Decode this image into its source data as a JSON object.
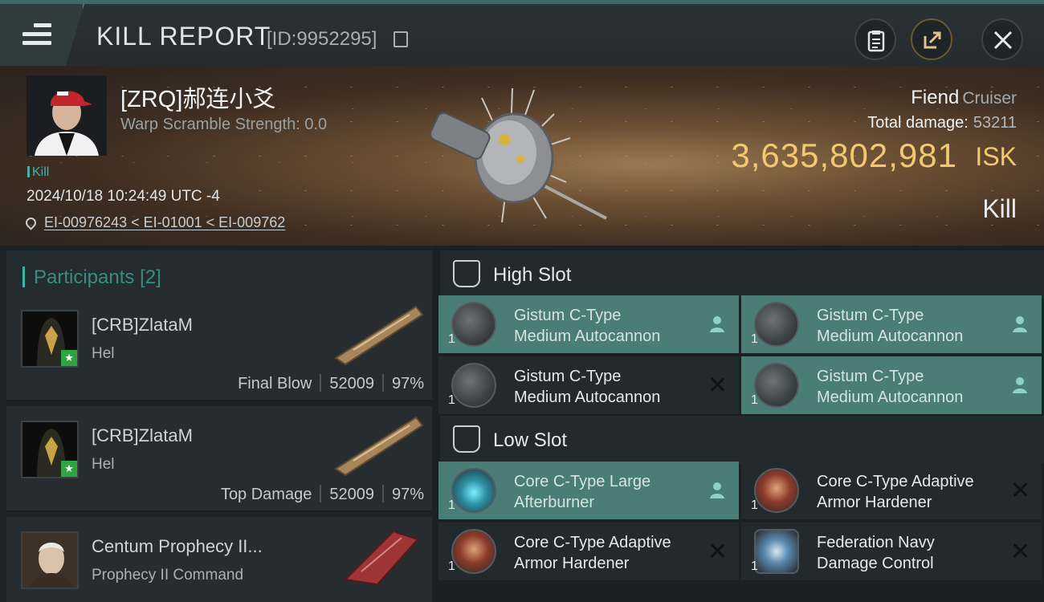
{
  "header": {
    "title": "KILL REPORT",
    "report_id": "[ID:9952295]",
    "icons": {
      "menu": "hamburger-menu-icon",
      "copy": "copy-icon",
      "clipboard": "clipboard-icon",
      "share": "share-icon",
      "close": "close-icon"
    }
  },
  "victim": {
    "name": "[ZRQ]郝连小爻",
    "warp_scramble": "Warp Scramble Strength: 0.0",
    "tag": "Kill",
    "timestamp": "2024/10/18 10:24:49 UTC -4",
    "location": "EI-00976243 < EI-01001 < EI-009762",
    "ship_name": "Fiend",
    "ship_class": "Cruiser",
    "total_damage_label": "Total damage:",
    "total_damage": "53211",
    "isk_value": "3,635,802,981",
    "isk_unit": "ISK",
    "result": "Kill"
  },
  "participants": {
    "title": "Participants",
    "count": "[2]",
    "rows": [
      {
        "name": "[CRB]ZlataM",
        "ship": "Hel",
        "role": "Final Blow",
        "damage": "52009",
        "percent": "97%"
      },
      {
        "name": "[CRB]ZlataM",
        "ship": "Hel",
        "role": "Top Damage",
        "damage": "52009",
        "percent": "97%"
      },
      {
        "name": "Centum Prophecy II...",
        "ship": "Prophecy II Command",
        "role": "",
        "damage": "",
        "percent": ""
      }
    ]
  },
  "fitting": {
    "high_slot": {
      "title": "High Slot",
      "modules": [
        {
          "qty": "1",
          "line1": "Gistum C-Type",
          "line2": "Medium Autocannon",
          "status": "dropped"
        },
        {
          "qty": "1",
          "line1": "Gistum C-Type",
          "line2": "Medium Autocannon",
          "status": "dropped"
        },
        {
          "qty": "1",
          "line1": "Gistum C-Type",
          "line2": "Medium Autocannon",
          "status": "destroyed"
        },
        {
          "qty": "1",
          "line1": "Gistum C-Type",
          "line2": "Medium Autocannon",
          "status": "dropped"
        }
      ]
    },
    "low_slot": {
      "title": "Low Slot",
      "modules": [
        {
          "qty": "1",
          "line1": "Core C-Type Large",
          "line2": "Afterburner",
          "status": "dropped"
        },
        {
          "qty": "1",
          "line1": "Core C-Type Adaptive",
          "line2": "Armor Hardener",
          "status": "destroyed"
        },
        {
          "qty": "1",
          "line1": "Core C-Type Adaptive",
          "line2": "Armor Hardener",
          "status": "destroyed"
        },
        {
          "qty": "1",
          "line1": "Federation Navy",
          "line2": "Damage Control",
          "status": "destroyed"
        }
      ]
    }
  },
  "colors": {
    "accent": "#4a7d78",
    "isk": "#f2c870",
    "teal": "#3fb5a8"
  }
}
